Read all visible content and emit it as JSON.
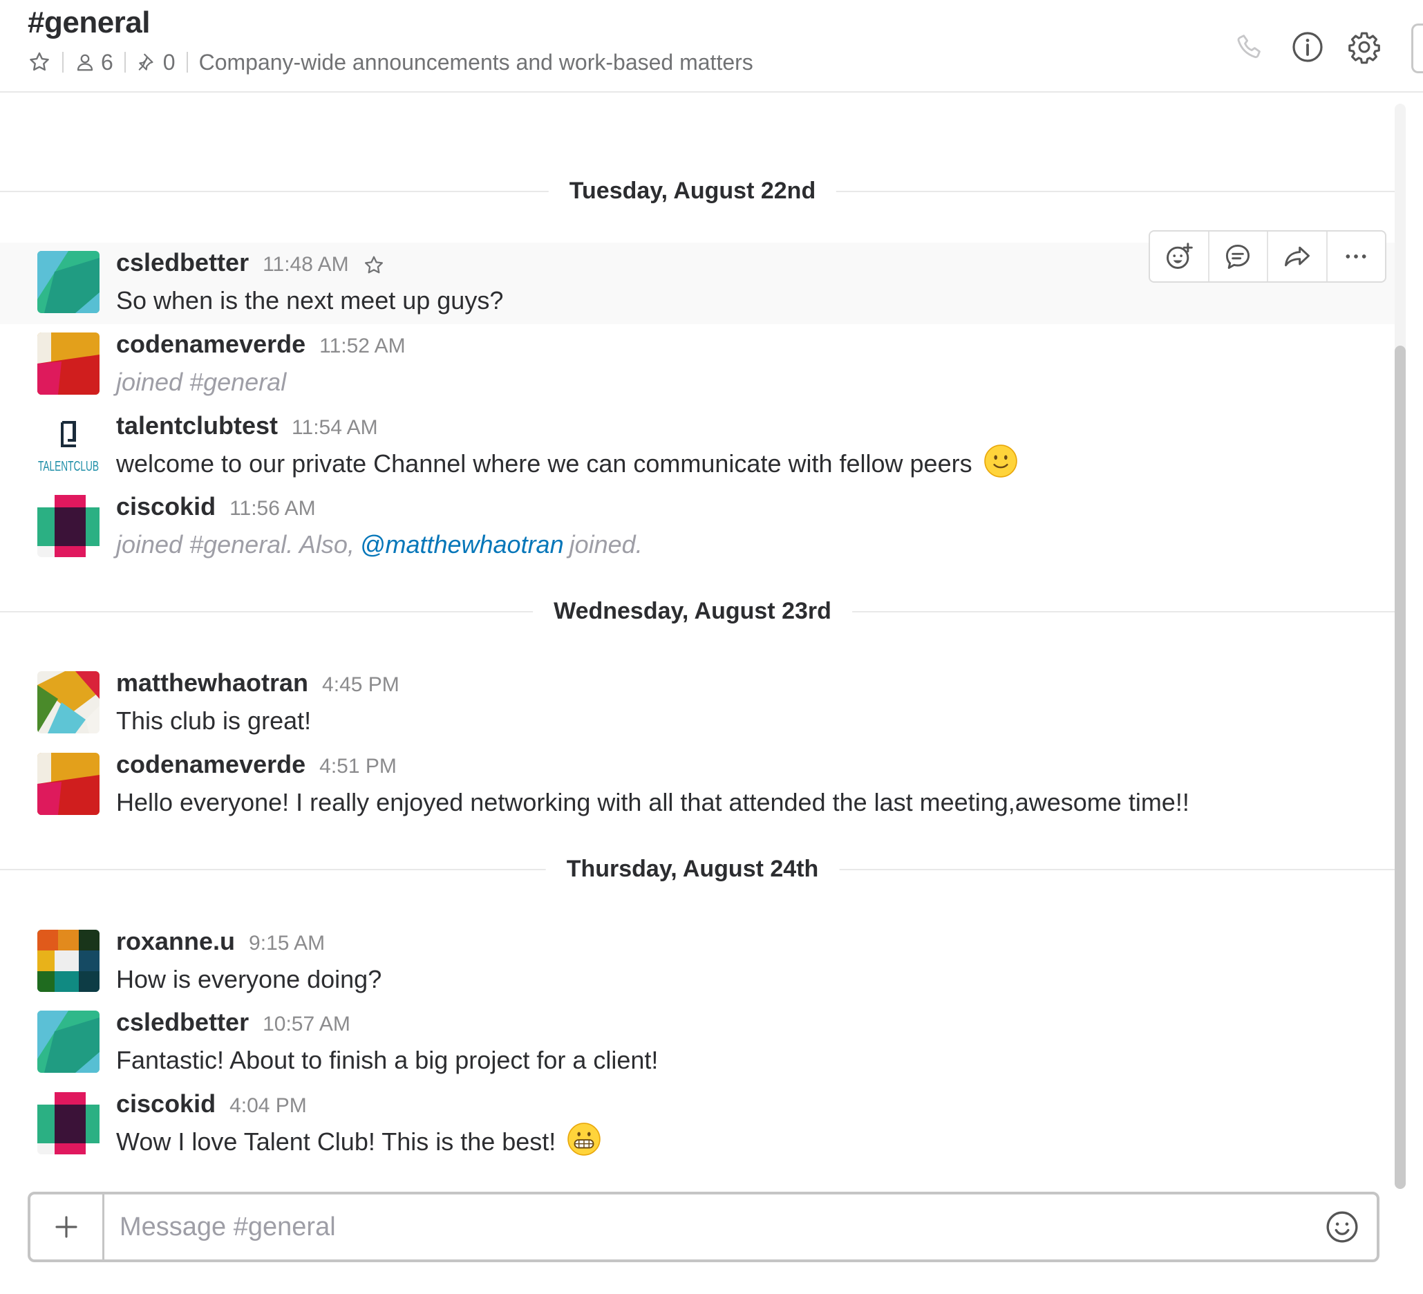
{
  "header": {
    "channel_name": "#general",
    "member_count": "6",
    "pinned_count": "0",
    "topic": "Company-wide announcements and work-based matters"
  },
  "dividers": [
    {
      "label": "Tuesday, August 22nd"
    },
    {
      "label": "Wednesday, August 23rd"
    },
    {
      "label": "Thursday, August 24th"
    }
  ],
  "messages": [
    {
      "user": "csledbetter",
      "time": "11:48 AM",
      "text": "So when is the next meet up guys?",
      "avatar": "avatar-csledbetter"
    },
    {
      "user": "codenameverde",
      "time": "11:52 AM",
      "text": "joined #general",
      "avatar": "avatar-codenameverde"
    },
    {
      "user": "talentclubtest",
      "time": "11:54 AM",
      "text": "welcome to our private Channel where we can communicate with fellow peers",
      "avatar": "avatar-talentclub-logo",
      "emoji": "slightly-smiling-face-emoji"
    },
    {
      "user": "ciscokid",
      "time": "11:56 AM",
      "text_before": "joined #general. Also,",
      "mention": "@matthewhaotran",
      "text_after": "joined.",
      "avatar": "avatar-ciscokid"
    },
    {
      "user": "matthewhaotran",
      "time": "4:45 PM",
      "text": "This club is great!",
      "avatar": "avatar-matthewhaotran"
    },
    {
      "user": "codenameverde",
      "time": "4:51 PM",
      "text": "Hello everyone! I really enjoyed networking with all that attended the last meeting,awesome time!!",
      "avatar": "avatar-codenameverde"
    },
    {
      "user": "roxanne.u",
      "time": "9:15 AM",
      "text": "How is everyone doing?",
      "avatar": "avatar-roxanne"
    },
    {
      "user": "csledbetter",
      "time": "10:57 AM",
      "text": "Fantastic! About to finish a big project for a client!",
      "avatar": "avatar-csledbetter"
    },
    {
      "user": "ciscokid",
      "time": "4:04 PM",
      "text": "Wow I love Talent Club! This is the best!",
      "avatar": "avatar-ciscokid",
      "emoji": "grimacing-face-emoji"
    }
  ],
  "talentclub_logo_text": "TALENTCLUB",
  "composer": {
    "placeholder": "Message #general",
    "value": ""
  },
  "icons": {
    "star": "star-icon",
    "members": "person-icon",
    "pins": "pin-icon",
    "call": "phone-icon",
    "info": "info-icon",
    "settings": "gear-icon",
    "add_reaction": "add-reaction-icon",
    "reply": "comment-bubble-icon",
    "share": "share-arrow-icon",
    "more": "more-actions-icon",
    "attach": "plus-icon",
    "composer_emoji": "smiley-icon"
  },
  "colors": {
    "mention": "#0576b9",
    "muted_text": "#9e9ea6",
    "timestamp": "#8b8b8d",
    "hover_bg": "#f9f9f9"
  }
}
